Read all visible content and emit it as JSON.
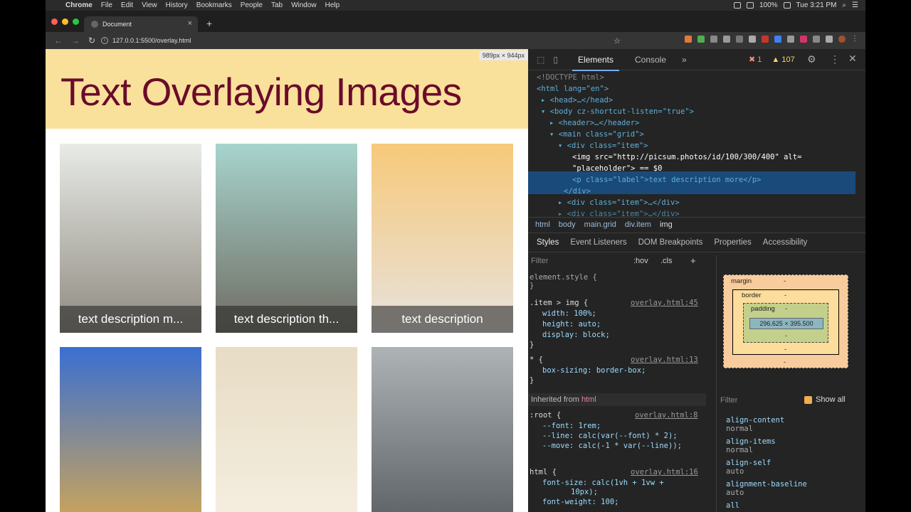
{
  "menubar": {
    "apple": "",
    "items": [
      "Chrome",
      "File",
      "Edit",
      "View",
      "History",
      "Bookmarks",
      "People",
      "Tab",
      "Window",
      "Help"
    ],
    "battery": "100%",
    "clock": "Tue 3:21 PM"
  },
  "browser": {
    "tab_title": "Document",
    "tab_close": "×",
    "new_tab": "+",
    "url": "127.0.0.1:5500/overlay.html"
  },
  "page": {
    "title": "Text Overlaying Images",
    "dims_badge": "989px × 944px",
    "items": [
      {
        "label": "text description m...",
        "color_top": "#e8ebe7",
        "color_bottom": "#8f8a80"
      },
      {
        "label": "text description th...",
        "color_top": "#a7d4cd",
        "color_bottom": "#6f6c62"
      },
      {
        "label": "text description",
        "color_top": "#f7c97a",
        "color_bottom": "#e7e2dd"
      },
      {
        "label": "",
        "color_top": "#3a6fd1",
        "color_bottom": "#c9a45c"
      },
      {
        "label": "",
        "color_top": "#e7dcc4",
        "color_bottom": "#f5eee0"
      },
      {
        "label": "",
        "color_top": "#aeb3b6",
        "color_bottom": "#5e6468"
      }
    ]
  },
  "devtools": {
    "tabs": {
      "elements": "Elements",
      "console": "Console",
      "more": "»"
    },
    "errors": "1",
    "warnings": "107",
    "breadcrumbs": [
      "html",
      "body",
      "main.grid",
      "div.item",
      "img"
    ],
    "subtabs": [
      "Styles",
      "Event Listeners",
      "DOM Breakpoints",
      "Properties",
      "Accessibility"
    ],
    "filter_placeholder": "Filter",
    "hov": ":hov",
    "cls": ".cls",
    "plus": "+",
    "element_style": "element.style {",
    "inherited_label": "Inherited from",
    "inherited_from": "html",
    "boxmodel": {
      "margin": "margin",
      "border": "border",
      "padding": "padding",
      "content": "296.625 × 395.500",
      "dash": "-"
    },
    "computed": {
      "filter": "Filter",
      "show_all": "Show all",
      "props": [
        {
          "k": "align-content",
          "v": "normal"
        },
        {
          "k": "align-items",
          "v": "normal"
        },
        {
          "k": "align-self",
          "v": "auto"
        },
        {
          "k": "alignment-baseline",
          "v": "auto"
        },
        {
          "k": "all",
          "v": ""
        }
      ]
    }
  },
  "dom": {
    "doctype": "<!DOCTYPE html>",
    "html_open": "<html lang=\"en\">",
    "head": "<head>…</head>",
    "body_open": "<body cz-shortcut-listen=\"true\">",
    "header": "<header>…</header>",
    "main": "<main class=\"grid\">",
    "div_item": "<div class=\"item\">",
    "img_1": "<img src=\"http://picsum.photos/id/100/300/400\" alt=",
    "img_2": "\"placeholder\"> == $0",
    "p": "<p class=\"label\">text description more</p>",
    "div_close": "</div>",
    "div_item_2": "<div class=\"item\">…</div>",
    "div_item_3": "<div class=\"item\">…</div>"
  },
  "styles": {
    "rule1_sel": ".item > img {",
    "rule1_src": "overlay.html:45",
    "rule1_props": [
      "width: 100%;",
      "height: auto;",
      "display: block;"
    ],
    "rule2_sel": "* {",
    "rule2_src": "overlay.html:13",
    "rule2_props": [
      "box-sizing: border-box;"
    ],
    "rule3_sel": ":root {",
    "rule3_src": "overlay.html:8",
    "rule3_props": [
      "--font: 1rem;",
      "--line: calc(var(--font) * 2);",
      "--move: calc(-1 * var(--line));"
    ],
    "rule4_sel": "html {",
    "rule4_src": "overlay.html:16",
    "rule4_props": [
      "font-size: calc(1vh + 1vw +",
      "10px);",
      "font-weight: 100;"
    ],
    "close": "}"
  }
}
